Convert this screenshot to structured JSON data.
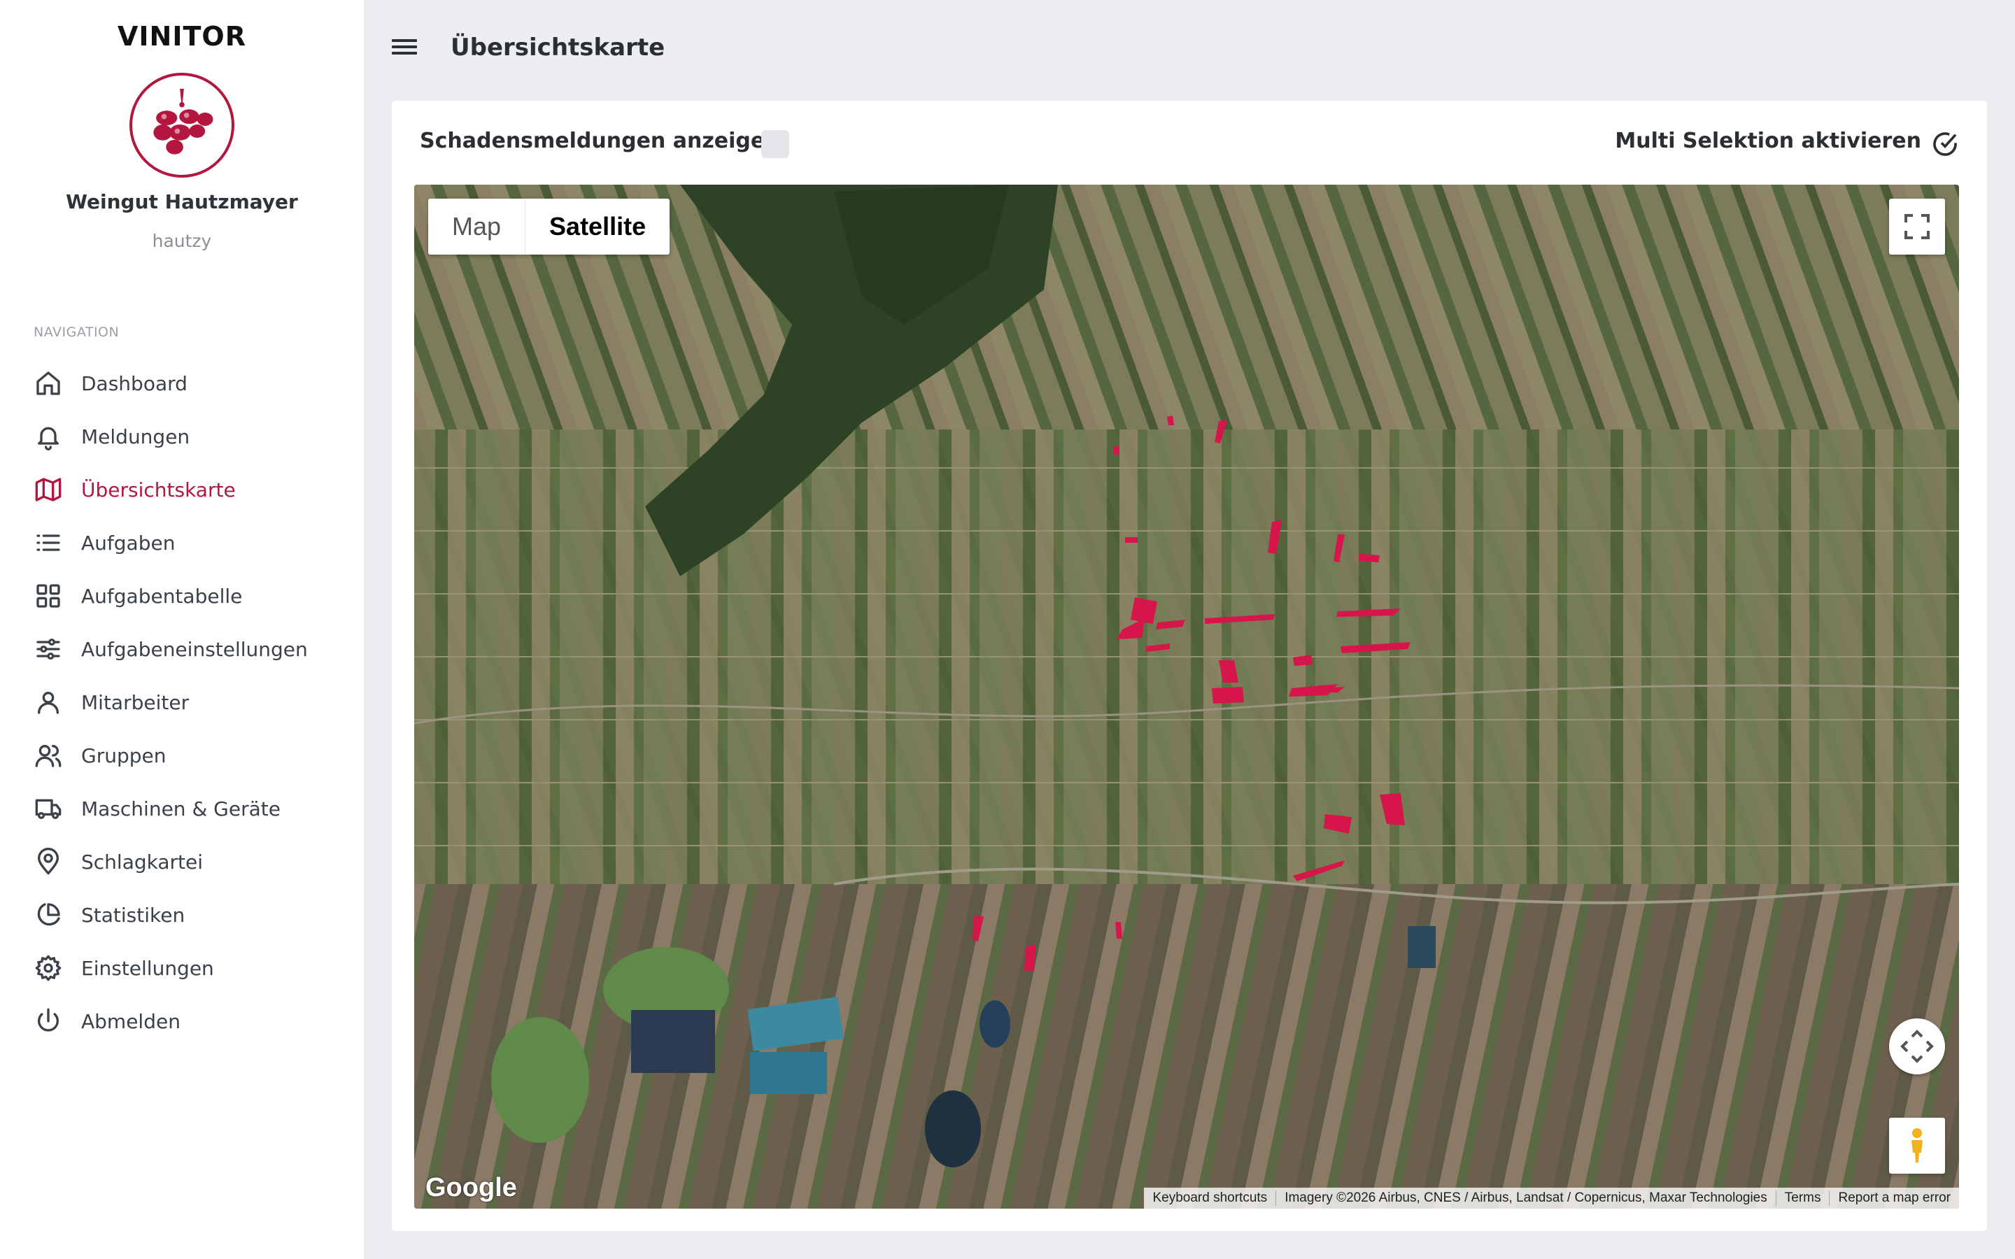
{
  "sidebar": {
    "brand": "VINITOR",
    "org_name": "Weingut Hautzmayer",
    "user_name": "hautzy",
    "nav_heading": "NAVIGATION",
    "items": [
      {
        "label": "Dashboard",
        "icon": "home-icon"
      },
      {
        "label": "Meldungen",
        "icon": "bell-icon"
      },
      {
        "label": "Übersichtskarte",
        "icon": "map-icon",
        "active": true
      },
      {
        "label": "Aufgaben",
        "icon": "list-icon"
      },
      {
        "label": "Aufgabentabelle",
        "icon": "grid-icon"
      },
      {
        "label": "Aufgabeneinstellungen",
        "icon": "sliders-icon"
      },
      {
        "label": "Mitarbeiter",
        "icon": "user-icon"
      },
      {
        "label": "Gruppen",
        "icon": "users-icon"
      },
      {
        "label": "Maschinen & Geräte",
        "icon": "truck-icon"
      },
      {
        "label": "Schlagkartei",
        "icon": "map-pin-icon"
      },
      {
        "label": "Statistiken",
        "icon": "pie-chart-icon"
      },
      {
        "label": "Einstellungen",
        "icon": "gear-icon"
      },
      {
        "label": "Abmelden",
        "icon": "power-icon"
      }
    ]
  },
  "header": {
    "title": "Übersichtskarte"
  },
  "card": {
    "damage_toggle_label": "Schadensmeldungen anzeigen",
    "damage_toggle_checked": false,
    "multi_select_label": "Multi Selektion aktivieren"
  },
  "map": {
    "map_type_map": "Map",
    "map_type_satellite": "Satellite",
    "selected_type": "Satellite",
    "logo": "Google",
    "attribution": {
      "shortcuts": "Keyboard shortcuts",
      "imagery": "Imagery ©2026 Airbus, CNES / Airbus, Landsat / Copernicus, Maxar Technologies",
      "terms": "Terms",
      "report": "Report a map error"
    }
  },
  "colors": {
    "accent": "#b3163f",
    "parcel": "#d6154a",
    "background": "#eceef1"
  }
}
